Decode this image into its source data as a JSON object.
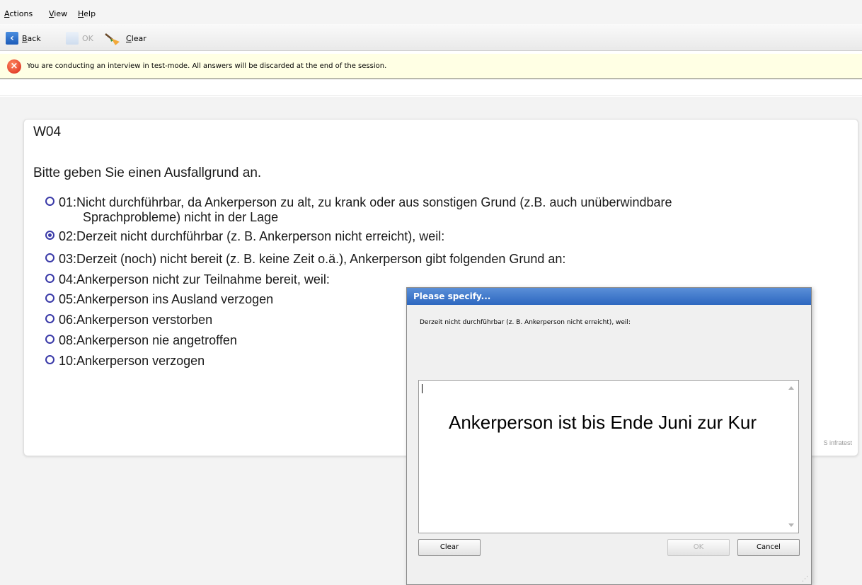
{
  "menu": {
    "actions": "Actions",
    "view": "View",
    "help": "Help"
  },
  "toolbar": {
    "back_label": "Back",
    "ok_label": "OK",
    "clear_label": "Clear"
  },
  "warning": {
    "icon": "error-x-icon",
    "text": "You are conducting an interview in test-mode. All answers will be discarded at the end of the session."
  },
  "question": {
    "id": "W04",
    "text": "Bitte geben Sie einen Ausfallgrund an.",
    "options": [
      {
        "code": "01",
        "line1": "01:Nicht durchführbar, da Ankerperson zu alt, zu krank oder aus sonstigen Grund (z.B. auch unüberwindbare",
        "line2": "Sprachprobleme) nicht in der Lage",
        "selected": false
      },
      {
        "code": "02",
        "label": "02:Derzeit nicht durchführbar (z. B. Ankerperson nicht erreicht), weil:",
        "selected": true
      },
      {
        "code": "03",
        "label": "03:Derzeit (noch) nicht bereit (z. B. keine Zeit o.ä.), Ankerperson gibt folgenden Grund an:",
        "selected": false
      },
      {
        "code": "04",
        "label": "04:Ankerperson nicht zur Teilnahme bereit, weil:",
        "selected": false
      },
      {
        "code": "05",
        "label": "05:Ankerperson ins Ausland verzogen",
        "selected": false
      },
      {
        "code": "06",
        "label": "06:Ankerperson verstorben",
        "selected": false
      },
      {
        "code": "08",
        "label": "08:Ankerperson nie angetroffen",
        "selected": false
      },
      {
        "code": "10",
        "label": "10:Ankerperson verzogen",
        "selected": false
      }
    ],
    "copyright": "S infratest"
  },
  "dialog": {
    "title": "Please specify...",
    "prompt": "Derzeit nicht durchführbar (z. B. Ankerperson nicht erreicht), weil:",
    "value": "Ankerperson ist bis Ende Juni zur Kur",
    "clear_label": "Clear",
    "ok_label": "OK",
    "cancel_label": "Cancel"
  },
  "colors": {
    "warning_bg": "#ffffe4",
    "dialog_title": "#2d67c0",
    "radio": "#3a3aa8"
  }
}
